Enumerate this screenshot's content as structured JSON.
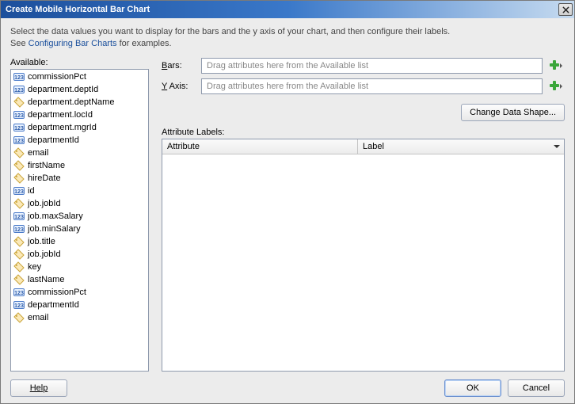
{
  "window": {
    "title": "Create Mobile Horizontal Bar Chart"
  },
  "description": {
    "line1": "Select the data values you want to display for the bars and the y axis of your chart, and then configure their labels.",
    "line2_prefix": "See ",
    "link_text": "Configuring Bar Charts",
    "line2_suffix": " for examples."
  },
  "available": {
    "label": "Available:",
    "items": [
      {
        "icon": "num",
        "text": "commissionPct"
      },
      {
        "icon": "num",
        "text": "department.deptId"
      },
      {
        "icon": "tag",
        "text": "department.deptName"
      },
      {
        "icon": "num",
        "text": "department.locId"
      },
      {
        "icon": "num",
        "text": "department.mgrId"
      },
      {
        "icon": "num",
        "text": "departmentId"
      },
      {
        "icon": "tag",
        "text": "email"
      },
      {
        "icon": "tag",
        "text": "firstName"
      },
      {
        "icon": "tag",
        "text": "hireDate"
      },
      {
        "icon": "num",
        "text": "id"
      },
      {
        "icon": "tag",
        "text": "job.jobId"
      },
      {
        "icon": "num",
        "text": "job.maxSalary"
      },
      {
        "icon": "num",
        "text": "job.minSalary"
      },
      {
        "icon": "tag",
        "text": "job.title"
      },
      {
        "icon": "tag",
        "text": "job.jobId"
      },
      {
        "icon": "tag",
        "text": "key"
      },
      {
        "icon": "tag",
        "text": "lastName"
      },
      {
        "icon": "num",
        "text": "commissionPct"
      },
      {
        "icon": "num",
        "text": "departmentId"
      },
      {
        "icon": "tag",
        "text": "email"
      }
    ]
  },
  "drops": {
    "bars_label": "Bars:",
    "bars_ul": "B",
    "bars_placeholder": "Drag attributes here from the Available list",
    "yaxis_label": "Y Axis:",
    "yaxis_ul": "Y",
    "yaxis_placeholder": "Drag attributes here from the Available list"
  },
  "change_data_shape": "Change Data Shape...",
  "attr_labels": {
    "title": "Attribute Labels:",
    "col_attribute": "Attribute",
    "col_label": "Label"
  },
  "footer": {
    "help": "Help",
    "ok": "OK",
    "cancel": "Cancel"
  }
}
